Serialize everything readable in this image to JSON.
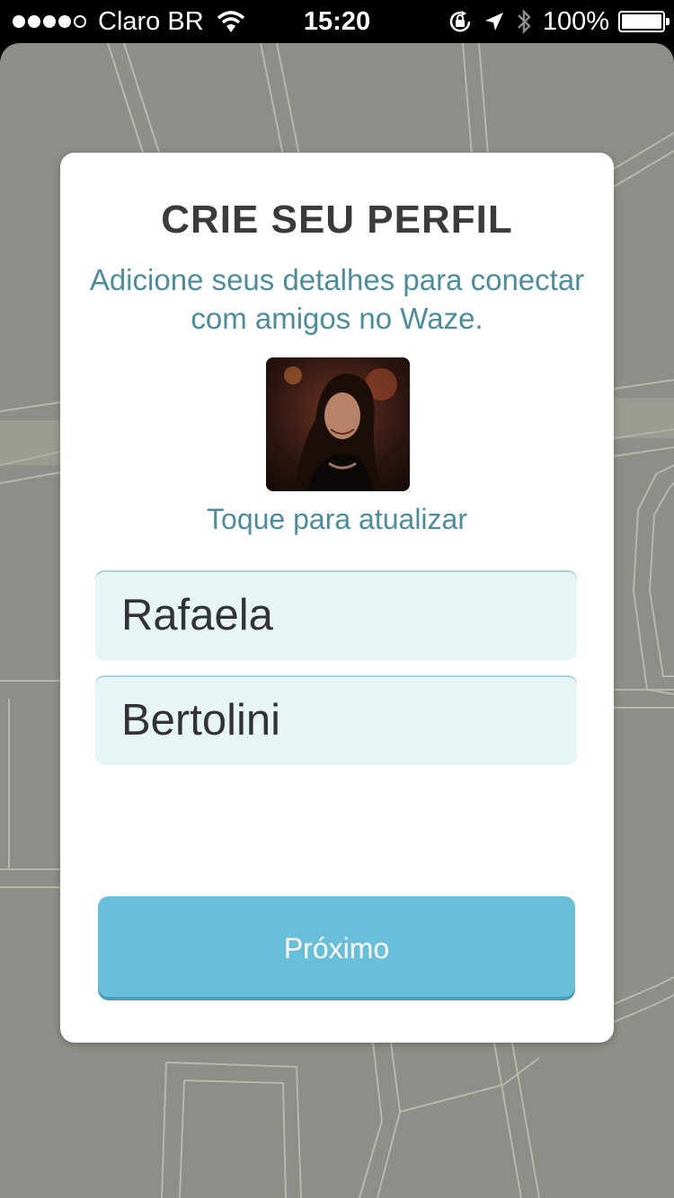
{
  "status_bar": {
    "carrier": "Claro BR",
    "time": "15:20",
    "battery": "100%",
    "signal_bars_filled": 4,
    "signal_bars_total": 5,
    "icons": [
      "wifi-icon",
      "orientation-lock-icon",
      "location-arrow-icon",
      "bluetooth-icon",
      "battery-icon"
    ]
  },
  "dialog": {
    "title": "CRIE SEU PERFIL",
    "subtitle": "Adicione seus detalhes para conectar com amigos no Waze.",
    "tap_hint": "Toque para atualizar",
    "first_name": "Rafaela",
    "last_name": "Bertolini",
    "next_button": "Próximo"
  },
  "colors": {
    "accent_text": "#4b8d9c",
    "button": "#68bfd9",
    "field_background": "#e8f5f7",
    "map_background": "#8e8d87"
  }
}
